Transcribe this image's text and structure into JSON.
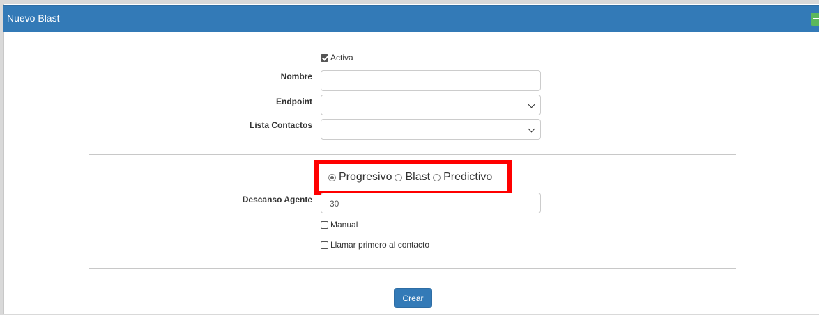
{
  "panel": {
    "title": "Nuevo Blast"
  },
  "form": {
    "activa_label": "Activa",
    "activa_checked": true,
    "nombre_label": "Nombre",
    "nombre_value": "",
    "endpoint_label": "Endpoint",
    "endpoint_value": "",
    "lista_label": "Lista Contactos",
    "lista_value": "",
    "mode_options": [
      "Progresivo",
      "Blast",
      "Predictivo"
    ],
    "mode_selected": "Progresivo",
    "descanso_label": "Descanso Agente",
    "descanso_value": "30",
    "manual_label": "Manual",
    "manual_checked": false,
    "llamar_label": "Llamar primero al contacto",
    "llamar_checked": false,
    "submit_label": "Crear"
  },
  "colors": {
    "header": "#337ab7",
    "highlight": "#ff0000",
    "collapse_button": "#5cb85c"
  }
}
